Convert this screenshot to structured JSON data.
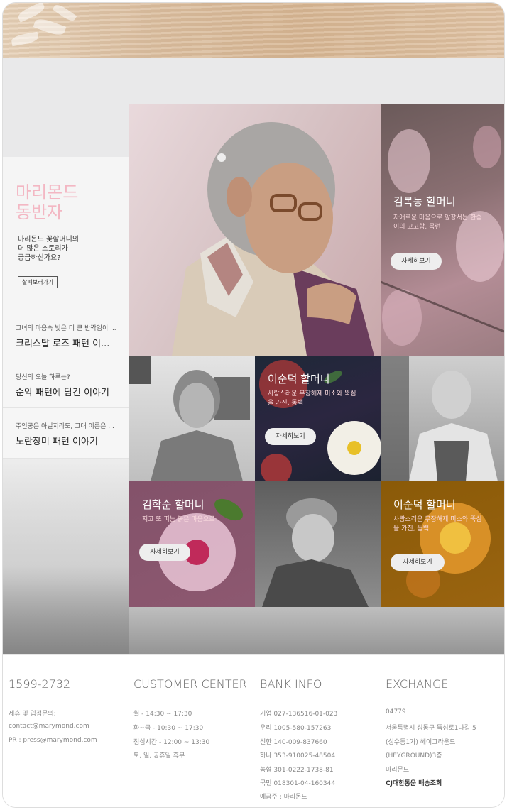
{
  "promo": {
    "title": "마리몬드\n동반자",
    "subtitle": "마리몬드 꽃할머니의\n더 많은 스토리가\n궁금하신가요?",
    "button": "살펴보러가기"
  },
  "stories": [
    {
      "teaser": "그녀의 마음속 빛은 더 큰 반짝임이 ...",
      "title": "크리스탈 로즈 패턴 이..."
    },
    {
      "teaser": "당신의 오늘 하루는?",
      "title": "순악 패턴에 담긴 이야기"
    },
    {
      "teaser": "주인공은 아닐지라도, 그대 이름은 ...",
      "title": "노란장미 패턴 이야기"
    }
  ],
  "tiles": [
    {
      "name": "김복동 할머니",
      "desc": "자애로운 마음으로 앞장서는 한송\n이의 고고함, 목련",
      "button": "자세히보기"
    },
    {
      "name": "이순덕 할머니",
      "desc": "사랑스러운 무장해제 미소와 뚝심\n을 가진, 동백",
      "button": "자세히보기"
    },
    {
      "name": "김학순 할머니",
      "desc": "지고 또 피는 붉은 마음으로",
      "button": "자세히보기"
    },
    {
      "name": "이순덕 할머니",
      "desc": "사랑스러운 무장해제 미소와 뚝심\n을 가진, 동백",
      "button": "자세히보기"
    }
  ],
  "footer": {
    "phone": {
      "heading": "1599-2732",
      "lines": [
        "제휴 및 입점문의:",
        "contact@marymond.com",
        "PR : press@marymond.com"
      ]
    },
    "customer": {
      "heading": "CUSTOMER CENTER",
      "lines": [
        "월 - 14:30 ~ 17:30",
        "화~금 - 10:30 ~ 17:30",
        "점심시간 - 12:00 ~ 13:30",
        "토, 일, 공휴일 휴무"
      ]
    },
    "bank": {
      "heading": "BANK INFO",
      "lines": [
        "기업 027-136516-01-023",
        "우리 1005-580-157263",
        "신한 140-009-837660",
        "하나 353-910025-48504",
        "농협 301-0222-1738-81",
        "국민 018301-04-160344",
        "예금주 : 마리몬드"
      ]
    },
    "exchange": {
      "heading": "EXCHANGE",
      "lines": [
        "04779",
        "서울특별시 성동구 뚝섬로1나길 5",
        "(성수동1가) 헤이그라운드",
        "(HEYGROUND)3층",
        "마리몬드",
        "CJ대한통운 배송조회"
      ]
    }
  }
}
